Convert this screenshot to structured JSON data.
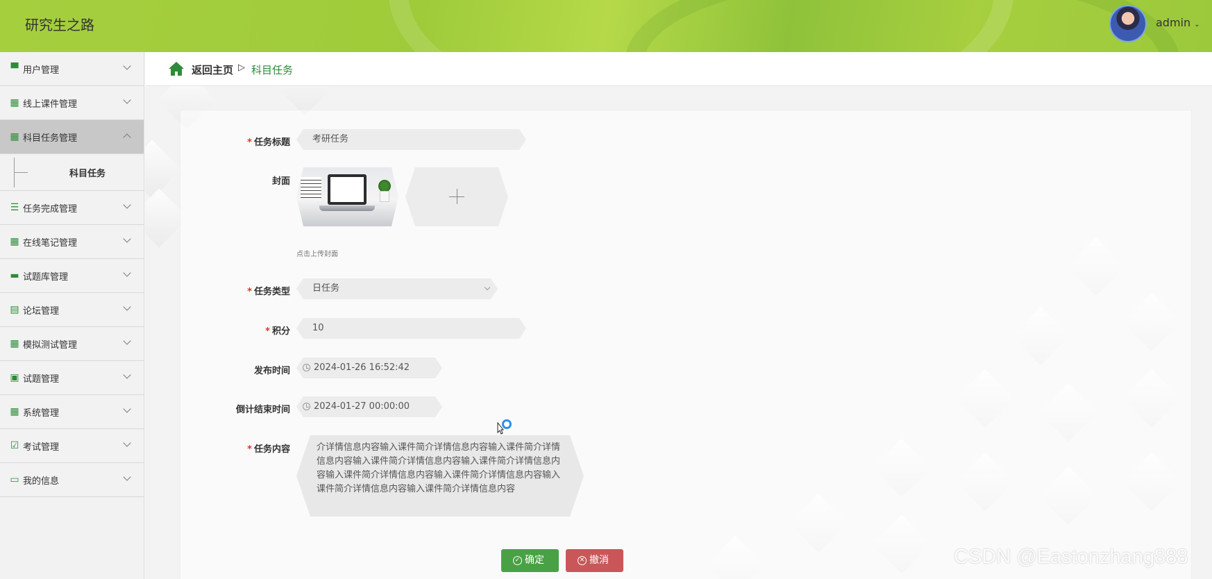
{
  "header": {
    "app_title": "研究生之路",
    "user_name": "admin"
  },
  "sidebar": {
    "items": [
      {
        "label": "用户管理",
        "icon": "pin-icon"
      },
      {
        "label": "线上课件管理",
        "icon": "grid-icon"
      },
      {
        "label": "科目任务管理",
        "icon": "grid-icon",
        "expanded": true,
        "sub_label": "科目任务"
      },
      {
        "label": "任务完成管理",
        "icon": "list-icon"
      },
      {
        "label": "在线笔记管理",
        "icon": "grid-icon"
      },
      {
        "label": "试题库管理",
        "icon": "monitor-icon"
      },
      {
        "label": "论坛管理",
        "icon": "clipboard-icon"
      },
      {
        "label": "模拟测试管理",
        "icon": "grid-icon"
      },
      {
        "label": "试题管理",
        "icon": "wallet-icon"
      },
      {
        "label": "系统管理",
        "icon": "grid-icon"
      },
      {
        "label": "考试管理",
        "icon": "checkbox-icon"
      },
      {
        "label": "我的信息",
        "icon": "card-icon"
      }
    ]
  },
  "breadcrumb": {
    "back": "返回主页",
    "separator": "▷",
    "current": "科目任务"
  },
  "form": {
    "task_title": {
      "label": "任务标题",
      "value": "考研任务"
    },
    "cover": {
      "label": "封面",
      "hint": "点击上传封面"
    },
    "task_type": {
      "label": "任务类型",
      "value": "日任务"
    },
    "points": {
      "label": "积分",
      "value": "10"
    },
    "publish_time": {
      "label": "发布时间",
      "value": "2024-01-26 16:52:42"
    },
    "deadline": {
      "label": "倒计结束时间",
      "value": "2024-01-27 00:00:00"
    },
    "content": {
      "label": "任务内容",
      "value": "介详情信息内容输入课件简介详情信息内容输入课件简介详情信息内容输入课件简介详情信息内容输入课件简介详情信息内容输入课件简介详情信息内容输入课件简介详情信息内容输入课件简介详情信息内容输入课件简介详情信息内容"
    },
    "confirm_label": "确定",
    "cancel_label": "撤消",
    "required_mark": "*"
  },
  "watermark": "CSDN @Eastonzhang888",
  "colors": {
    "accent": "#2e8b3a",
    "header": "#a6cf3e",
    "confirm": "#48a245",
    "cancel": "#c9575a"
  }
}
